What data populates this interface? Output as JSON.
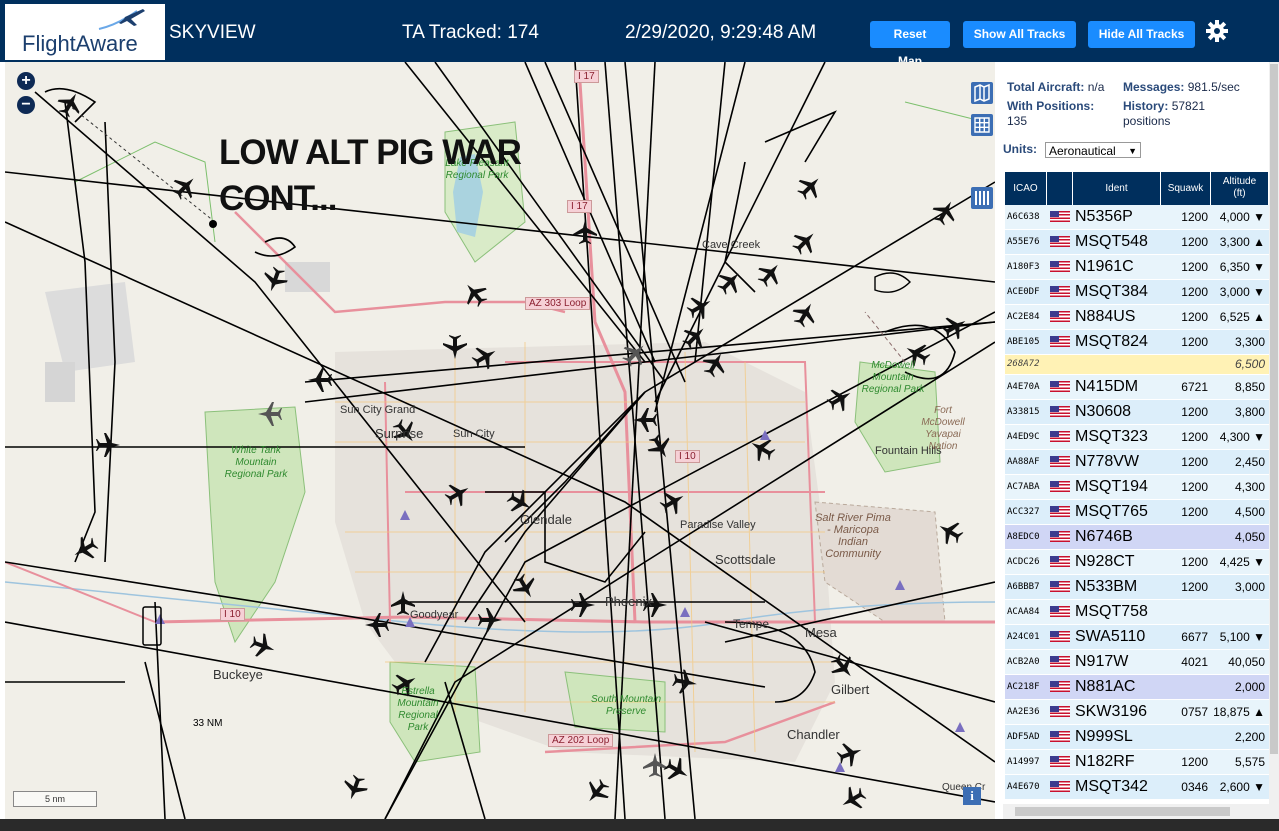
{
  "header": {
    "logo_text_a": "Flight",
    "logo_text_b": "Aware",
    "app_name": "SKYVIEW",
    "ta_tracked": "TA Tracked: 174",
    "datetime": "2/29/2020, 9:29:48 AM",
    "reset_label": "Reset Map",
    "show_tracks_label": "Show All Tracks",
    "hide_tracks_label": "Hide All Tracks",
    "settings_icon": "gear-icon"
  },
  "map": {
    "overlay_note_line1": "LOW ALT PIG WAR",
    "overlay_note_line2": "CONT...",
    "zoom_in": "+",
    "zoom_out": "−",
    "scale_nm": "33 NM",
    "scale_bar": "5 nm",
    "info": "i",
    "places": {
      "sun_city_grand": "Sun City Grand",
      "surprise": "Surprise",
      "sun_city": "Sun City",
      "glendale": "Glendale",
      "phoenix": "Phoenix",
      "tempe": "Tempe",
      "mesa": "Mesa",
      "gilbert": "Gilbert",
      "chandler": "Chandler",
      "scottsdale": "Scottsdale",
      "paradise_valley": "Paradise Valley",
      "goodyear": "Goodyear",
      "buckeye": "Buckeye",
      "cave_creek": "Cave Creek",
      "fountain_hills": "Fountain Hills",
      "queen_creek": "Queen Cr"
    },
    "parks": {
      "lake_pleasant": "Lake Pleasant Regional Park",
      "white_tank": "White Tank Mountain Regional Park",
      "mcdowell": "McDowell Mountain Regional Park",
      "fort_mcdowell": "Fort McDowell Yavapai Nation",
      "salt_river": "Salt River Pima - Maricopa Indian Community",
      "estrella": "Estrella Mountain Regional Park",
      "south_mountain": "South Mountain Preserve"
    },
    "roads": {
      "i17": "I 17",
      "i10": "I 10",
      "az303": "AZ 303 Loop",
      "az202": "AZ 202 Loop",
      "i10b": "I 10"
    },
    "colors": {
      "land": "#f1efe8",
      "water": "#aad3df",
      "park": "#c8e3b4",
      "urban": "#e0dcd6",
      "highway": "#e8909c",
      "track": "#000000"
    }
  },
  "sidebar": {
    "total_aircraft_label": "Total Aircraft:",
    "total_aircraft_value": "n/a",
    "messages_label": "Messages:",
    "messages_value": "981.5/sec",
    "with_positions_label": "With Positions:",
    "with_positions_value": "135",
    "history_label": "History:",
    "history_value": "57821",
    "history_suffix": "positions",
    "units_label": "Units:",
    "units_value": "Aeronautical",
    "columns": {
      "icao": "ICAO",
      "ident": "Ident",
      "squawk": "Squawk",
      "altitude_line1": "Altitude",
      "altitude_line2": "(ft)"
    },
    "rows": [
      {
        "icao": "A6C638",
        "ident": "N5356P",
        "squawk": "1200",
        "alt": "4,000 ▼",
        "style": "alt"
      },
      {
        "icao": "A55E76",
        "ident": "MSQT548",
        "squawk": "1200",
        "alt": "3,300 ▲",
        "style": ""
      },
      {
        "icao": "A180F3",
        "ident": "N1961C",
        "squawk": "1200",
        "alt": "6,350 ▼",
        "style": "alt"
      },
      {
        "icao": "ACE0DF",
        "ident": "MSQT384",
        "squawk": "1200",
        "alt": "3,000 ▼",
        "style": ""
      },
      {
        "icao": "AC2E84",
        "ident": "N884US",
        "squawk": "1200",
        "alt": "6,525 ▲",
        "style": "alt"
      },
      {
        "icao": "ABE105",
        "ident": "MSQT824",
        "squawk": "1200",
        "alt": "3,300",
        "style": ""
      },
      {
        "icao": "268A72",
        "ident": "",
        "squawk": "",
        "alt": "6,500",
        "style": "yel"
      },
      {
        "icao": "A4E70A",
        "ident": "N415DM",
        "squawk": "6721",
        "alt": "8,850",
        "style": "alt"
      },
      {
        "icao": "A33815",
        "ident": "N30608",
        "squawk": "1200",
        "alt": "3,800",
        "style": ""
      },
      {
        "icao": "A4ED9C",
        "ident": "MSQT323",
        "squawk": "1200",
        "alt": "4,300 ▼",
        "style": "alt"
      },
      {
        "icao": "AA88AF",
        "ident": "N778VW",
        "squawk": "1200",
        "alt": "2,450",
        "style": ""
      },
      {
        "icao": "AC7ABA",
        "ident": "MSQT194",
        "squawk": "1200",
        "alt": "4,300",
        "style": "alt"
      },
      {
        "icao": "ACC327",
        "ident": "MSQT765",
        "squawk": "1200",
        "alt": "4,500",
        "style": ""
      },
      {
        "icao": "A8EDC0",
        "ident": "N6746B",
        "squawk": "",
        "alt": "4,050",
        "style": "sel"
      },
      {
        "icao": "ACDC26",
        "ident": "N928CT",
        "squawk": "1200",
        "alt": "4,425 ▼",
        "style": "alt"
      },
      {
        "icao": "A6BBB7",
        "ident": "N533BM",
        "squawk": "1200",
        "alt": "3,000",
        "style": ""
      },
      {
        "icao": "ACAA84",
        "ident": "MSQT758",
        "squawk": "",
        "alt": "",
        "style": "alt"
      },
      {
        "icao": "A24C01",
        "ident": "SWA5110",
        "squawk": "6677",
        "alt": "5,100 ▼",
        "style": ""
      },
      {
        "icao": "ACB2A0",
        "ident": "N917W",
        "squawk": "4021",
        "alt": "40,050",
        "style": "alt"
      },
      {
        "icao": "AC218F",
        "ident": "N881AC",
        "squawk": "",
        "alt": "2,000",
        "style": "sel"
      },
      {
        "icao": "AA2E36",
        "ident": "SKW3196",
        "squawk": "0757",
        "alt": "18,875 ▲",
        "style": "alt"
      },
      {
        "icao": "ADF5AD",
        "ident": "N999SL",
        "squawk": "",
        "alt": "2,200",
        "style": ""
      },
      {
        "icao": "A14997",
        "ident": "N182RF",
        "squawk": "1200",
        "alt": "5,575",
        "style": "alt"
      },
      {
        "icao": "A4E670",
        "ident": "MSQT342",
        "squawk": "0346",
        "alt": "2,600 ▼",
        "style": ""
      }
    ]
  }
}
